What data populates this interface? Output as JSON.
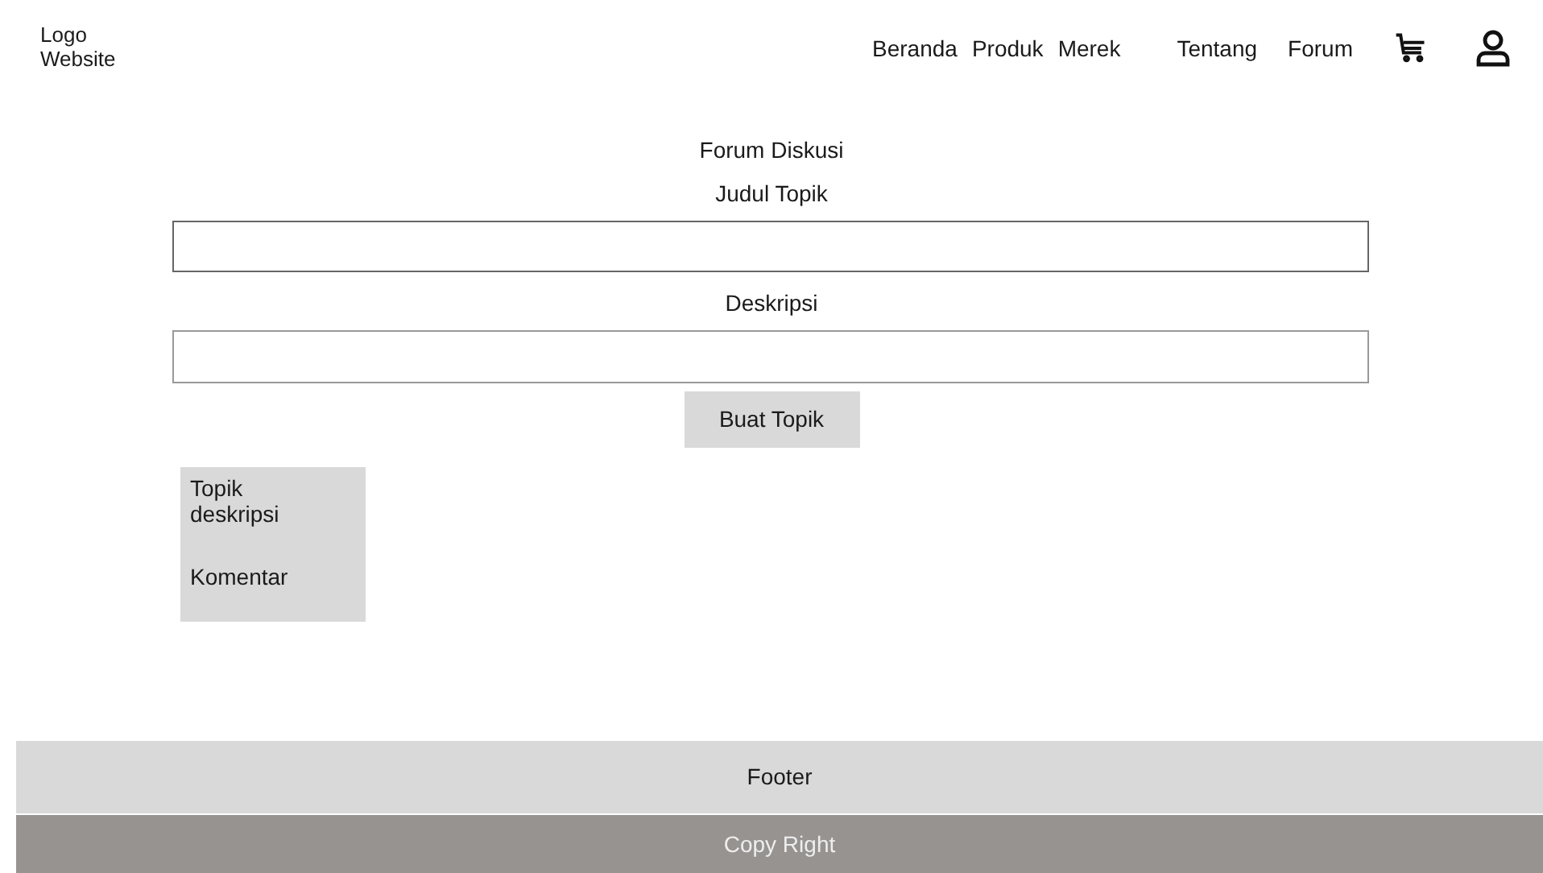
{
  "header": {
    "logo": "Logo Website",
    "nav": [
      {
        "label": "Beranda"
      },
      {
        "label": "Produk"
      },
      {
        "label": "Merek"
      },
      {
        "label": "Tentang"
      },
      {
        "label": "Forum"
      }
    ]
  },
  "form": {
    "title": "Forum Diskusi",
    "fields": [
      {
        "label": "Judul Topik"
      },
      {
        "label": "Deskripsi"
      }
    ],
    "button": "Buat Topik"
  },
  "topics": [
    {
      "text": "Topik deskripsi",
      "comment": "Komentar"
    }
  ],
  "footer": {
    "label": "Footer",
    "copyright": "Copy Right"
  }
}
